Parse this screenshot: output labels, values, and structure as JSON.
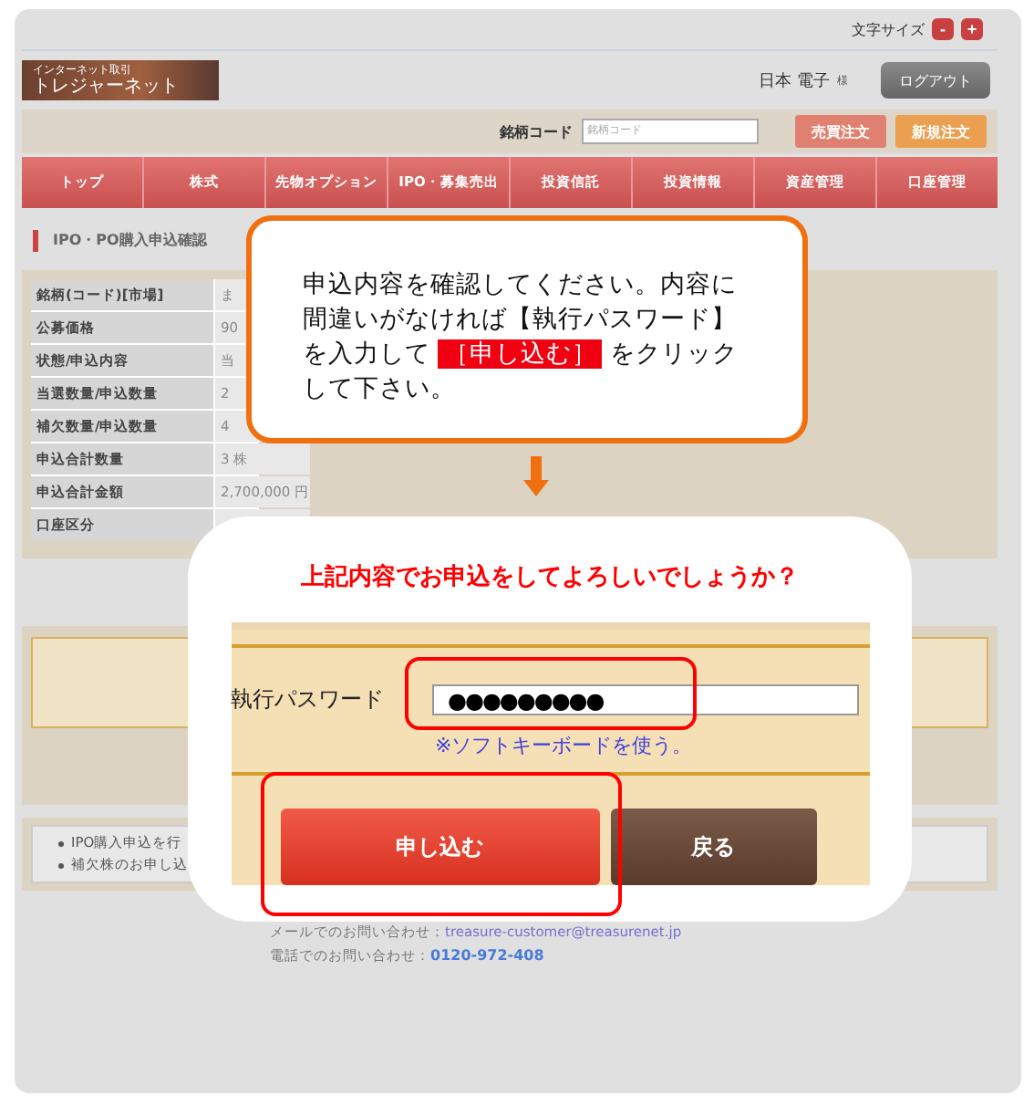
{
  "header": {
    "font_size_label": "文字サイズ",
    "font_size_buttons": [
      "-",
      "+"
    ]
  },
  "logo": {
    "tagline": "インターネット取引",
    "name": "トレジャーネット"
  },
  "user": {
    "name": "日本 電子",
    "honorific": "様"
  },
  "logout_button": "ログアウト",
  "search": {
    "label": "銘柄コード",
    "placeholder": "銘柄コード",
    "buttons": [
      {
        "label": "売買注文",
        "kind": "trade"
      },
      {
        "label": "新規注文",
        "kind": "new"
      }
    ]
  },
  "nav": [
    "トップ",
    "株式",
    "先物オプション",
    "IPO・募集売出",
    "投資信託",
    "投資情報",
    "資産管理",
    "口座管理"
  ],
  "page_title": "IPO・PO購入申込確認",
  "details": [
    {
      "label": "銘柄(コード)[市場]",
      "value": "ま"
    },
    {
      "label": "公募価格",
      "value": "90"
    },
    {
      "label": "状態/申込内容",
      "value": "当"
    },
    {
      "label": "当選数量/申込数量",
      "value": "2"
    },
    {
      "label": "補欠数量/申込数量",
      "value": "4"
    },
    {
      "label": "申込合計数量",
      "value": "3 株"
    },
    {
      "label": "申込合計金額",
      "value": "2,700,000 円"
    },
    {
      "label": "口座区分"
    }
  ],
  "notes": [
    "IPO購入申込を行",
    "補欠株のお申し込"
  ],
  "footer": {
    "mail_label": "メールでのお問い合わせ：",
    "mail": "treasure-customer@treasurenet.jp",
    "phone_label": "電話でのお問い合わせ：",
    "phone": "0120-972-408"
  },
  "callout": {
    "text": "申込内容を確認してください。内容に間違いがなければ【執行パスワード】を入力して **［申し込む］** をクリックして下さい。"
  },
  "confirm": {
    "question": "上記内容でお申込をしてよろしいでしょうか？",
    "password_label": "執行パスワード",
    "password_value": "●●●●●●●●●",
    "soft_keyboard_link": "※ソフトキーボードを使う。",
    "buttons": [
      {
        "label": "申し込む",
        "kind": "primary"
      },
      {
        "label": "戻る",
        "kind": "back"
      }
    ]
  }
}
